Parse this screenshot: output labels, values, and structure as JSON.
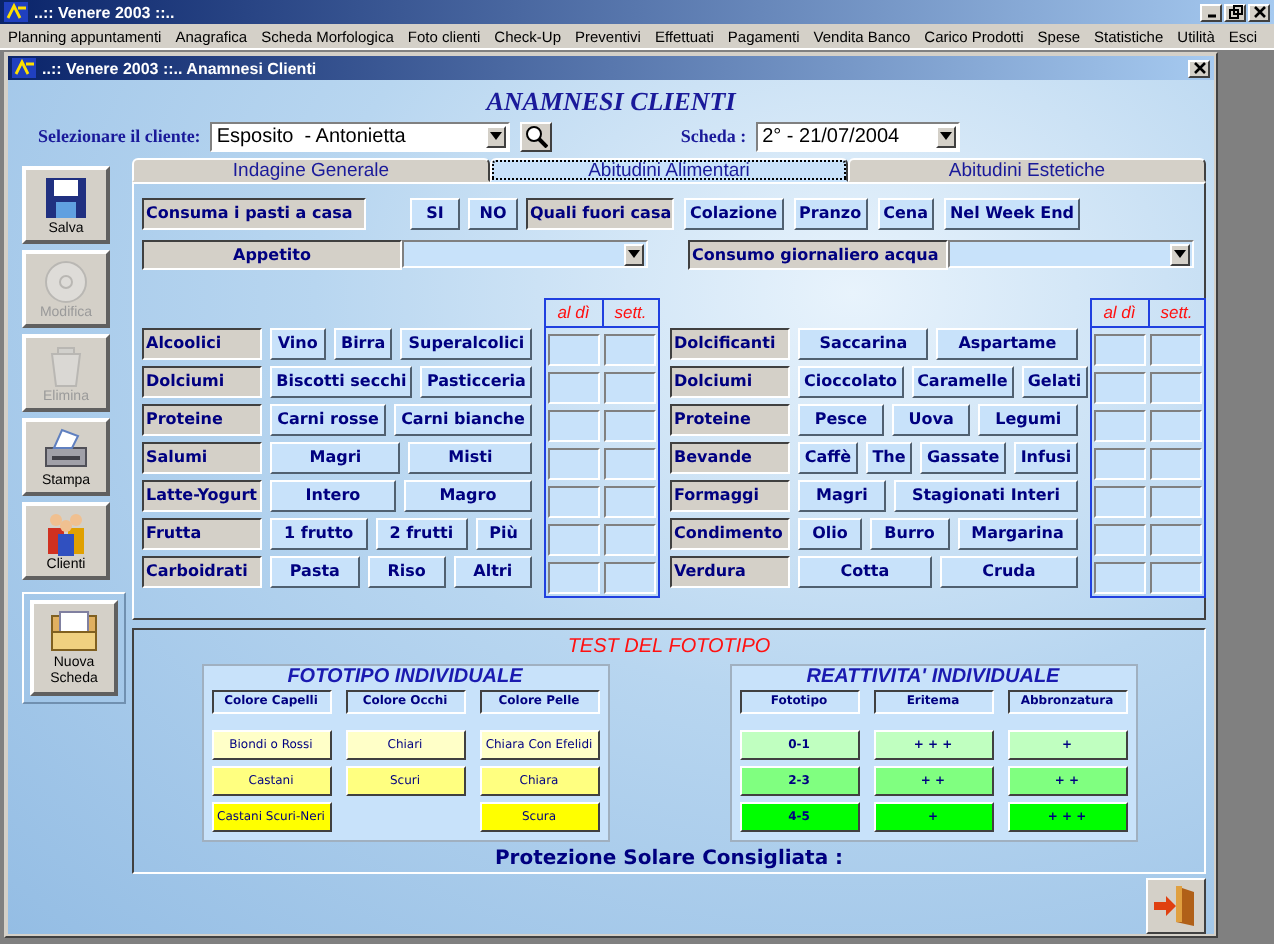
{
  "app_title": "..:: Venere 2003 ::..",
  "menu": [
    "Planning appuntamenti",
    "Anagrafica",
    "Scheda Morfologica",
    "Foto clienti",
    "Check-Up",
    "Preventivi",
    "Effettuati",
    "Pagamenti",
    "Vendita Banco",
    "Carico Prodotti",
    "Spese",
    "Statistiche",
    "Utilità",
    "Esci"
  ],
  "window": {
    "title": "..:: Venere 2003 ::.. Anamnesi Clienti"
  },
  "heading": "ANAMNESI CLIENTI",
  "client": {
    "label": "Selezionare il cliente:",
    "value": "Esposito  - Antonietta"
  },
  "sheet": {
    "label": "Scheda :",
    "value": "2° - 21/07/2004"
  },
  "toolbar": [
    {
      "kind": "save",
      "label": "Salva",
      "disabled": false
    },
    {
      "kind": "edit",
      "label": "Modifica",
      "disabled": true
    },
    {
      "kind": "delete",
      "label": "Elimina",
      "disabled": true
    },
    {
      "kind": "print",
      "label": "Stampa",
      "disabled": false
    },
    {
      "kind": "clients",
      "label": "Clienti",
      "disabled": false
    },
    {
      "kind": "new",
      "label": "Nuova Scheda",
      "disabled": false
    }
  ],
  "tabs": [
    {
      "label": "Indagine Generale",
      "selected": false
    },
    {
      "label": "Abitudini Alimentari",
      "selected": true
    },
    {
      "label": "Abitudini Estetiche",
      "selected": false
    }
  ],
  "meals": {
    "label": "Consuma i pasti a casa",
    "options": [
      "SI",
      "NO"
    ],
    "outside_label": "Quali fuori casa",
    "outside_options": [
      "Colazione",
      "Pranzo",
      "Cena",
      "Nel Week End"
    ]
  },
  "appetite": {
    "label": "Appetito"
  },
  "water": {
    "label": "Consumo giornaliero acqua"
  },
  "food_left": {
    "headers": [
      "al dì",
      "sett."
    ],
    "groups": [
      {
        "label": "Alcoolici",
        "options": [
          "Vino",
          "Birra",
          "Superalcolici"
        ]
      },
      {
        "label": "Dolciumi",
        "options": [
          "Biscotti secchi",
          "Pasticceria"
        ]
      },
      {
        "label": "Proteine",
        "options": [
          "Carni rosse",
          "Carni bianche"
        ]
      },
      {
        "label": "Salumi",
        "options": [
          "Magri",
          "Misti"
        ]
      },
      {
        "label": "Latte-Yogurt",
        "options": [
          "Intero",
          "Magro"
        ]
      },
      {
        "label": "Frutta",
        "options": [
          "1 frutto",
          "2 frutti",
          "Più"
        ]
      },
      {
        "label": "Carboidrati",
        "options": [
          "Pasta",
          "Riso",
          "Altri"
        ]
      }
    ]
  },
  "food_right": {
    "headers": [
      "al dì",
      "sett."
    ],
    "groups": [
      {
        "label": "Dolcificanti",
        "options": [
          "Saccarina",
          "Aspartame"
        ]
      },
      {
        "label": "Dolciumi",
        "options": [
          "Cioccolato",
          "Caramelle",
          "Gelati"
        ]
      },
      {
        "label": "Proteine",
        "options": [
          "Pesce",
          "Uova",
          "Legumi"
        ]
      },
      {
        "label": "Bevande",
        "options": [
          "Caffè",
          "The",
          "Gassate",
          "Infusi"
        ]
      },
      {
        "label": "Formaggi",
        "options": [
          "Magri",
          "Stagionati Interi"
        ]
      },
      {
        "label": "Condimento",
        "options": [
          "Olio",
          "Burro",
          "Margarina"
        ]
      },
      {
        "label": "Verdura",
        "options": [
          "Cotta",
          "Cruda"
        ]
      }
    ]
  },
  "test": {
    "title": "TEST DEL FOTOTIPO",
    "fototipo": {
      "title": "FOTOTIPO INDIVIDUALE",
      "columns": [
        {
          "header": "Colore Capelli",
          "items": [
            {
              "label": "Biondi o Rossi",
              "color": "#ffffc8"
            },
            {
              "label": "Castani",
              "color": "#ffff80"
            },
            {
              "label": "Castani Scuri-Neri",
              "color": "#ffff00"
            }
          ]
        },
        {
          "header": "Colore Occhi",
          "items": [
            {
              "label": "Chiari",
              "color": "#ffffc8"
            },
            {
              "label": "Scuri",
              "color": "#ffff80"
            }
          ]
        },
        {
          "header": "Colore Pelle",
          "items": [
            {
              "label": "Chiara Con Efelidi",
              "color": "#ffffc8"
            },
            {
              "label": "Chiara",
              "color": "#ffff80"
            },
            {
              "label": "Scura",
              "color": "#ffff00"
            }
          ]
        }
      ]
    },
    "reattivita": {
      "title": "REATTIVITA' INDIVIDUALE",
      "columns": [
        {
          "header": "Fototipo",
          "items": [
            {
              "label": "0-1",
              "color": "#c0ffc0"
            },
            {
              "label": "2-3",
              "color": "#80ff80"
            },
            {
              "label": "4-5",
              "color": "#00ff00"
            }
          ]
        },
        {
          "header": "Eritema",
          "items": [
            {
              "label": "+ + +",
              "color": "#c0ffc0"
            },
            {
              "label": "+ +",
              "color": "#80ff80"
            },
            {
              "label": "+",
              "color": "#00ff00"
            }
          ]
        },
        {
          "header": "Abbronzatura",
          "items": [
            {
              "label": "+",
              "color": "#c0ffc0"
            },
            {
              "label": "+ +",
              "color": "#80ff80"
            },
            {
              "label": "+ + +",
              "color": "#00ff00"
            }
          ]
        }
      ]
    },
    "protection_label": "Protezione Solare Consigliata :"
  }
}
